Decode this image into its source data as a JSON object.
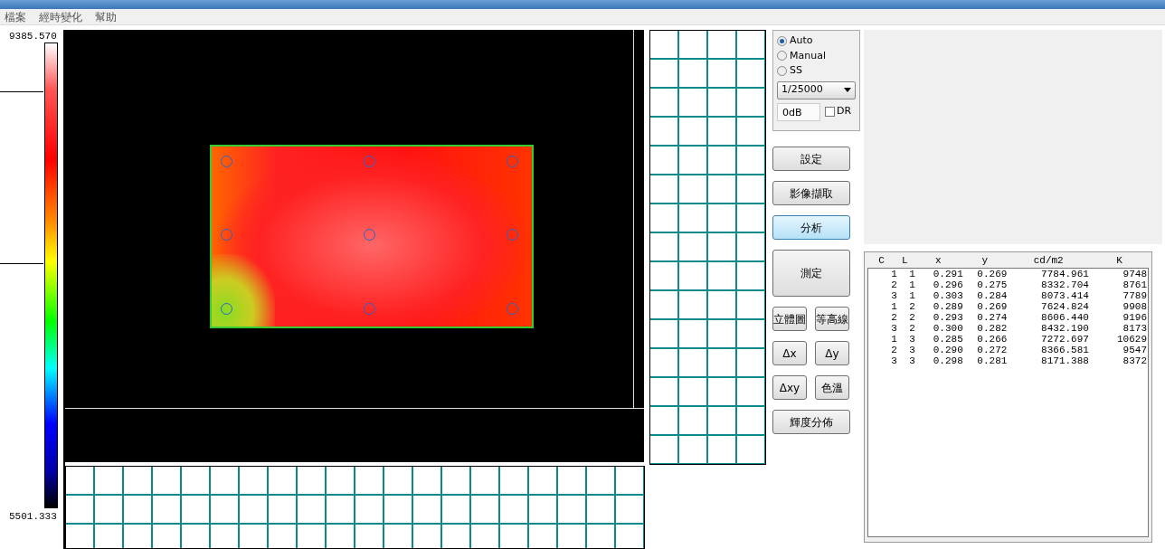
{
  "menu": [
    "檔案",
    "經時變化",
    "幫助"
  ],
  "colorbar": {
    "max": "9385.570",
    "min": "5501.333"
  },
  "exposure": [
    {
      "label": "Auto",
      "selected": true
    },
    {
      "label": "Manual",
      "selected": false
    },
    {
      "label": "SS",
      "selected": false
    }
  ],
  "shutter": {
    "value": "1/25000"
  },
  "gain": {
    "value": "0dB"
  },
  "dr": {
    "label": "DR",
    "checked": false
  },
  "buttons": [
    {
      "label": "設定",
      "kind": "wide",
      "selected": false
    },
    {
      "label": "影像擷取",
      "kind": "wide",
      "selected": false
    },
    {
      "label": "分析",
      "kind": "wide",
      "selected": true
    },
    {
      "label": "測定",
      "kind": "tall",
      "selected": false
    },
    {
      "label": "立體圖",
      "kind": "half",
      "selected": false
    },
    {
      "label": "等高線",
      "kind": "half",
      "selected": false
    },
    {
      "label": "Δx",
      "kind": "half",
      "selected": false
    },
    {
      "label": "Δy",
      "kind": "half",
      "selected": false
    },
    {
      "label": "Δxy",
      "kind": "half",
      "selected": false
    },
    {
      "label": "色溫",
      "kind": "half",
      "selected": false
    },
    {
      "label": "輝度分佈",
      "kind": "wide",
      "selected": false
    }
  ],
  "table": {
    "columns": [
      "C",
      "L",
      "x",
      "y",
      "cd/m2",
      "K"
    ],
    "rows": [
      [
        "1",
        "1",
        "0.291",
        "0.269",
        "7784.961",
        "9748"
      ],
      [
        "2",
        "1",
        "0.296",
        "0.275",
        "8332.704",
        "8761"
      ],
      [
        "3",
        "1",
        "0.303",
        "0.284",
        "8073.414",
        "7789"
      ],
      [
        "1",
        "2",
        "0.289",
        "0.269",
        "7624.824",
        "9908"
      ],
      [
        "2",
        "2",
        "0.293",
        "0.274",
        "8606.440",
        "9196"
      ],
      [
        "3",
        "2",
        "0.300",
        "0.282",
        "8432.190",
        "8173"
      ],
      [
        "1",
        "3",
        "0.285",
        "0.266",
        "7272.697",
        "10629"
      ],
      [
        "2",
        "3",
        "0.290",
        "0.272",
        "8366.581",
        "9547"
      ],
      [
        "3",
        "3",
        "0.298",
        "0.281",
        "8171.388",
        "8372"
      ]
    ]
  }
}
